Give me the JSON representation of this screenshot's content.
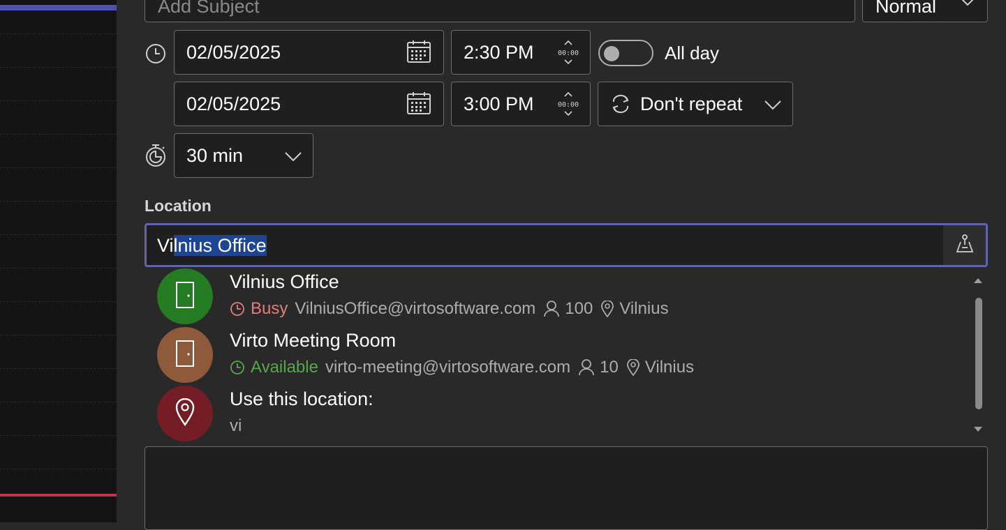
{
  "subject": {
    "placeholder": "Add Subject"
  },
  "importance": {
    "selected": "Normal"
  },
  "start": {
    "date": "02/05/2025",
    "time": "2:30 PM"
  },
  "end": {
    "date": "02/05/2025",
    "time": "3:00 PM"
  },
  "all_day": {
    "label": "All day",
    "checked": false
  },
  "repeat": {
    "selected": "Don't repeat"
  },
  "reminder": {
    "selected": "30 min"
  },
  "location": {
    "label": "Location",
    "typed": "Vi",
    "autocomplete": "lnius Office",
    "suggestions": [
      {
        "name": "Vilnius Office",
        "status": "Busy",
        "email": "VilniusOffice@virtosoftware.com",
        "capacity": "100",
        "city": "Vilnius",
        "avatar_color": "#237b22",
        "icon": "door-icon"
      },
      {
        "name": "Virto Meeting Room",
        "status": "Available",
        "email": "virto-meeting@virtosoftware.com",
        "capacity": "10",
        "city": "Vilnius",
        "avatar_color": "#8f5a3c",
        "icon": "door-icon"
      }
    ],
    "custom": {
      "label": "Use this location:",
      "value": "vi",
      "avatar_color": "#751d24",
      "icon": "map-pin-icon"
    }
  },
  "colors": {
    "accent": "#6264a7",
    "selection": "#1e4593",
    "busy": "#e37d80",
    "available": "#57a64a",
    "background": "#292929"
  }
}
